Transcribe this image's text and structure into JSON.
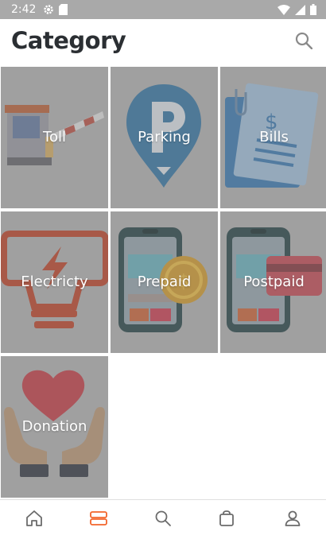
{
  "status": {
    "time": "2:42"
  },
  "header": {
    "title": "Category"
  },
  "categories": [
    {
      "label": "Toll"
    },
    {
      "label": "Parking"
    },
    {
      "label": "Bills"
    },
    {
      "label": "Electricty"
    },
    {
      "label": "Prepaid"
    },
    {
      "label": "Postpaid"
    },
    {
      "label": "Donation"
    }
  ],
  "bottom_nav": {
    "items": [
      "home-icon",
      "category-icon",
      "search-icon",
      "bag-icon",
      "profile-icon"
    ],
    "active_index": 1
  },
  "colors": {
    "accent": "#f2652b",
    "tile_bg": "#a6a6a6",
    "title": "#2b2f33"
  }
}
